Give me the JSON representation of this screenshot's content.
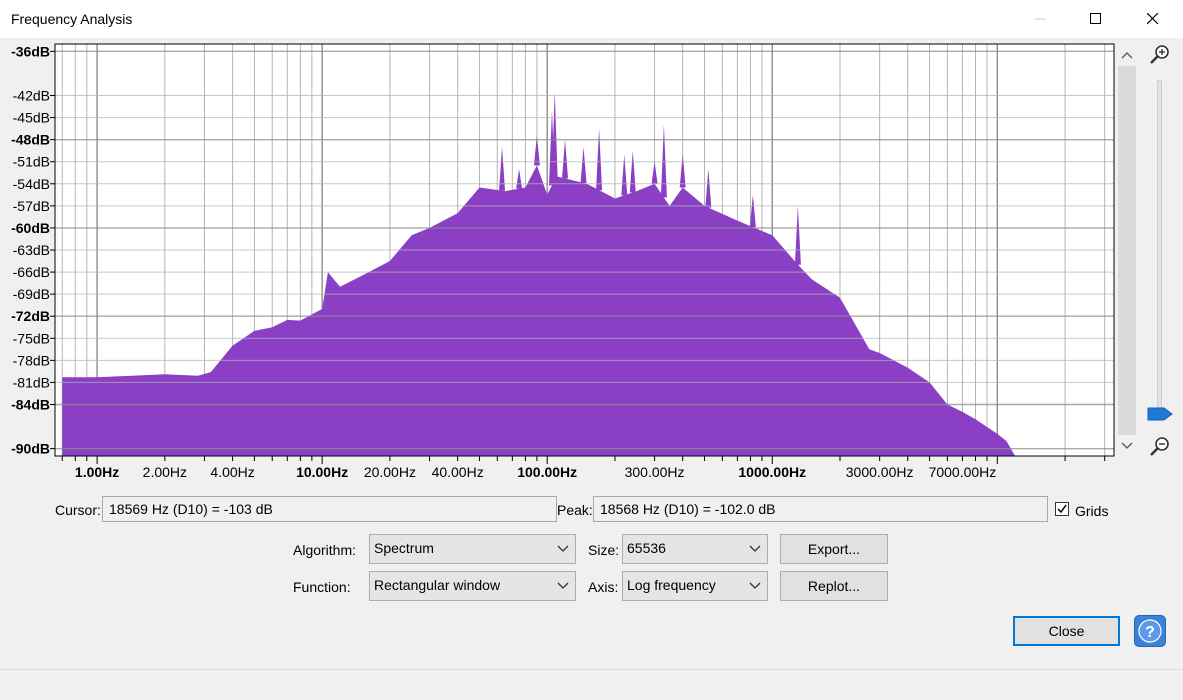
{
  "window": {
    "title": "Frequency Analysis",
    "controls": [
      "minimize-icon",
      "maximize-icon",
      "close-icon"
    ]
  },
  "plot": {
    "db_ticks": [
      "-36dB",
      "-42dB",
      "-45dB",
      "-48dB",
      "-51dB",
      "-54dB",
      "-57dB",
      "-60dB",
      "-63dB",
      "-66dB",
      "-69dB",
      "-72dB",
      "-75dB",
      "-78dB",
      "-81dB",
      "-84dB",
      "-90dB"
    ],
    "db_bold_ticks": [
      "-36dB",
      "-48dB",
      "-60dB",
      "-72dB",
      "-84dB",
      "-90dB"
    ],
    "freq_labels": [
      "1.00Hz",
      "2.00Hz",
      "4.00Hz",
      "10.00Hz",
      "20.00Hz",
      "40.00Hz",
      "100.00Hz",
      "300.00Hz",
      "1000.00Hz",
      "3000.00Hz",
      "7000.00Hz"
    ],
    "freq_bold_labels": [
      "1.00Hz",
      "10.00Hz",
      "100.00Hz",
      "1000.00Hz"
    ],
    "fill_color": "#8b3fc4",
    "grid_color": "#b4b4b4",
    "grid_major_color": "#8c8c8c",
    "grids": true,
    "x_scale": "log",
    "y_range_db": [
      -91,
      -35
    ],
    "x_range_hz": [
      0.65,
      33000
    ],
    "spectrum": {
      "freq_hz": [
        0.7,
        1,
        2,
        2.8,
        3.2,
        4,
        5,
        6,
        7,
        8,
        10,
        10.6,
        12,
        15,
        20,
        25,
        30,
        40,
        50,
        65,
        80,
        90,
        100,
        110,
        150,
        200,
        250,
        300,
        350,
        400,
        500,
        700,
        1000,
        1300,
        1500,
        2000,
        2700,
        3000,
        4000,
        5000,
        6000,
        7000,
        8000,
        10000,
        11000,
        12000
      ],
      "level_db": [
        -80.3,
        -80.3,
        -79.9,
        -80.1,
        -79.6,
        -76.0,
        -74.0,
        -73.5,
        -72.5,
        -72.6,
        -71.0,
        -66.0,
        -68.0,
        -66.5,
        -64.5,
        -61.0,
        -60.0,
        -58.0,
        -54.5,
        -55.0,
        -54.5,
        -51.5,
        -55.5,
        -53.0,
        -54.0,
        -56.0,
        -55.0,
        -54.0,
        -57.0,
        -54.5,
        -57.0,
        -59.0,
        -61.0,
        -65.0,
        -67.0,
        -69.5,
        -76.5,
        -77.0,
        -79.0,
        -81.0,
        -84.0,
        -85.0,
        -86.0,
        -88.0,
        -89.0,
        -91.0
      ],
      "peaks": [
        {
          "freq_hz": 63,
          "level_db": -49.0
        },
        {
          "freq_hz": 75,
          "level_db": -52.0
        },
        {
          "freq_hz": 90,
          "level_db": -47.5
        },
        {
          "freq_hz": 105,
          "level_db": -44.0
        },
        {
          "freq_hz": 108,
          "level_db": -41.5
        },
        {
          "freq_hz": 120,
          "level_db": -48.0
        },
        {
          "freq_hz": 145,
          "level_db": -49.0
        },
        {
          "freq_hz": 170,
          "level_db": -46.5
        },
        {
          "freq_hz": 220,
          "level_db": -50.0
        },
        {
          "freq_hz": 240,
          "level_db": -49.5
        },
        {
          "freq_hz": 300,
          "level_db": -51.0
        },
        {
          "freq_hz": 330,
          "level_db": -46.0
        },
        {
          "freq_hz": 400,
          "level_db": -50.0
        },
        {
          "freq_hz": 520,
          "level_db": -52.0
        },
        {
          "freq_hz": 820,
          "level_db": -55.5
        },
        {
          "freq_hz": 1300,
          "level_db": -57.0
        }
      ]
    }
  },
  "cursor": {
    "label": "Cursor:",
    "value": "18569 Hz (D10) = -103 dB"
  },
  "peak": {
    "label": "Peak:",
    "value": "18568 Hz (D10) = -102.0 dB"
  },
  "grids": {
    "label": "Grids",
    "checked": true
  },
  "algorithm": {
    "label": "Algorithm:",
    "value": "Spectrum"
  },
  "size": {
    "label": "Size:",
    "value": "65536"
  },
  "function": {
    "label": "Function:",
    "value": "Rectangular window"
  },
  "axis": {
    "label": "Axis:",
    "value": "Log frequency"
  },
  "buttons": {
    "export": "Export...",
    "replot": "Replot...",
    "close": "Close",
    "help": "?"
  },
  "scroll": {
    "up_icon": "chevron-up-icon",
    "down_icon": "chevron-down-icon",
    "zoom_in_icon": "zoom-in-icon",
    "zoom_out_icon": "zoom-out-icon",
    "slider_level": 0.0
  }
}
